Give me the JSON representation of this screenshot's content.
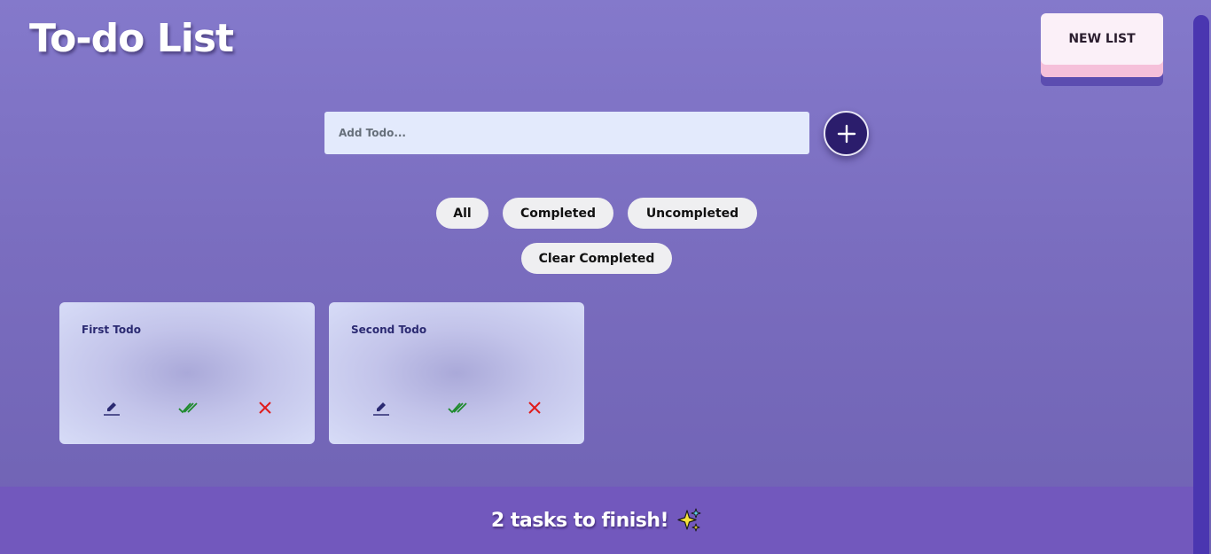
{
  "header": {
    "title": "To-do List",
    "new_list_label": "NEW LIST"
  },
  "input": {
    "placeholder": "Add Todo...",
    "value": "",
    "add_icon": "plus-icon"
  },
  "filters": {
    "all": "All",
    "completed": "Completed",
    "uncompleted": "Uncompleted",
    "clear_completed": "Clear Completed"
  },
  "todos": [
    {
      "title": "First Todo",
      "actions": [
        "edit-icon",
        "complete-icon",
        "delete-icon"
      ]
    },
    {
      "title": "Second Todo",
      "actions": [
        "edit-icon",
        "complete-icon",
        "delete-icon"
      ]
    }
  ],
  "footer": {
    "message": "2 tasks to finish!",
    "icon": "sparkles-icon"
  },
  "colors": {
    "accent": "#2b1d6c",
    "footer": "#7258bd",
    "complete": "#1d8a2c",
    "delete": "#e01b1b"
  }
}
